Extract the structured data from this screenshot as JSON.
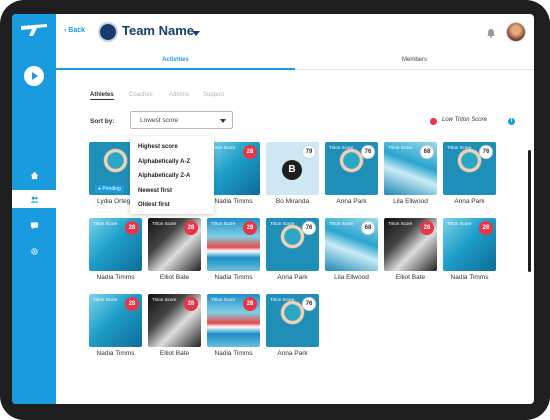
{
  "header": {
    "back_label": "Back",
    "team_name": "Team Name"
  },
  "tabs": [
    {
      "label": "Activities",
      "active": true
    },
    {
      "label": "Members",
      "active": false
    }
  ],
  "subtabs": [
    {
      "label": "Athletes",
      "active": true
    },
    {
      "label": "Coaches",
      "active": false
    },
    {
      "label": "Admins",
      "active": false
    },
    {
      "label": "Support",
      "active": false
    }
  ],
  "sort": {
    "label": "Sort by:",
    "selected": "Lowest score",
    "options": [
      "Highest score",
      "Alphabetically A-Z",
      "Alphabetically Z-A",
      "Newest first",
      "Oldest first"
    ]
  },
  "legend": {
    "low_score_label": "Low Triton Score",
    "low_color": "#e8354a",
    "info_icon": "i"
  },
  "colors": {
    "accent": "#1a9be0",
    "low": "#e8354a"
  },
  "score_caption": "Triton Score",
  "athletes": [
    {
      "name": "Lydia Ortega",
      "score": "",
      "status": "Pending",
      "photo": "swimmer",
      "low": false
    },
    {
      "name": "Nadia Timms",
      "score": "28",
      "status": "",
      "photo": "pool",
      "low": true
    },
    {
      "name": "Bo Miranda",
      "score": "79",
      "status": "",
      "photo": "blank",
      "initial": "B",
      "low": false
    },
    {
      "name": "Anna Park",
      "score": "76",
      "status": "",
      "photo": "swimmer",
      "low": false
    },
    {
      "name": "Lila Ellwood",
      "score": "68",
      "status": "",
      "photo": "lane",
      "low": false
    },
    {
      "name": "Anna Park",
      "score": "76",
      "status": "",
      "photo": "swimmer",
      "low": false
    },
    {
      "name": "Nadia Timms",
      "score": "28",
      "status": "",
      "photo": "pool",
      "low": true
    },
    {
      "name": "Elliot Bate",
      "score": "28",
      "status": "",
      "photo": "dark",
      "low": true
    },
    {
      "name": "Nadia Timms",
      "score": "28",
      "status": "",
      "photo": "flag",
      "low": true
    },
    {
      "name": "Anna Park",
      "score": "76",
      "status": "",
      "photo": "swimmer",
      "low": false
    },
    {
      "name": "Lila Ellwood",
      "score": "68",
      "status": "",
      "photo": "lane",
      "low": false
    },
    {
      "name": "Elliot Bate",
      "score": "28",
      "status": "",
      "photo": "dark",
      "low": true
    },
    {
      "name": "Nadia Timms",
      "score": "28",
      "status": "",
      "photo": "pool",
      "low": true
    },
    {
      "name": "Nadia Timms",
      "score": "28",
      "status": "",
      "photo": "pool",
      "low": true
    },
    {
      "name": "Elliot Bate",
      "score": "28",
      "status": "",
      "photo": "dark",
      "low": true
    },
    {
      "name": "Nadia Timms",
      "score": "28",
      "status": "",
      "photo": "flag",
      "low": true
    },
    {
      "name": "Anna Park",
      "score": "76",
      "status": "",
      "photo": "swimmer",
      "low": false
    }
  ]
}
